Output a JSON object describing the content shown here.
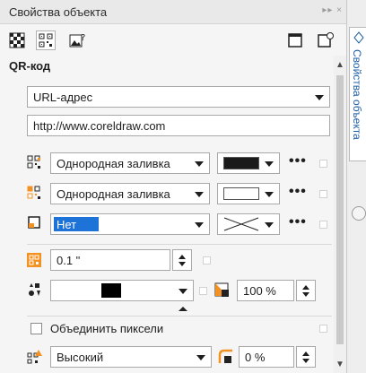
{
  "docker": {
    "title": "Свойства объекта",
    "title_controls": "▸▸ ×",
    "vertical_tab_label": "Свойства объекта"
  },
  "toolbar": {
    "icons": [
      "fill-pattern-icon",
      "qr-code-icon",
      "image-help-icon",
      "frame-icon",
      "frame-settings-icon"
    ]
  },
  "qr": {
    "section_title": "QR-код",
    "type_select": "URL-адрес",
    "url_value": "http://www.coreldraw.com",
    "row1_fill": "Однородная заливка",
    "row1_color": "#1a1a1a",
    "row2_fill": "Однородная заливка",
    "row2_color": "#ffffff",
    "row3_fill": "Нет",
    "row3_highlight": "#1e73d8",
    "size_value": "0.1 \"",
    "pixel_color": "#000000",
    "opacity_value": "100 %",
    "merge_pixels_label": "Объединить пиксели",
    "merge_pixels_checked": false,
    "error_correction": "Высокий",
    "roundness_value": "0 %"
  },
  "colors": {
    "accent_orange": "#f29222",
    "select_blue": "#1e73d8",
    "tab_text_blue": "#1f5fa8"
  }
}
